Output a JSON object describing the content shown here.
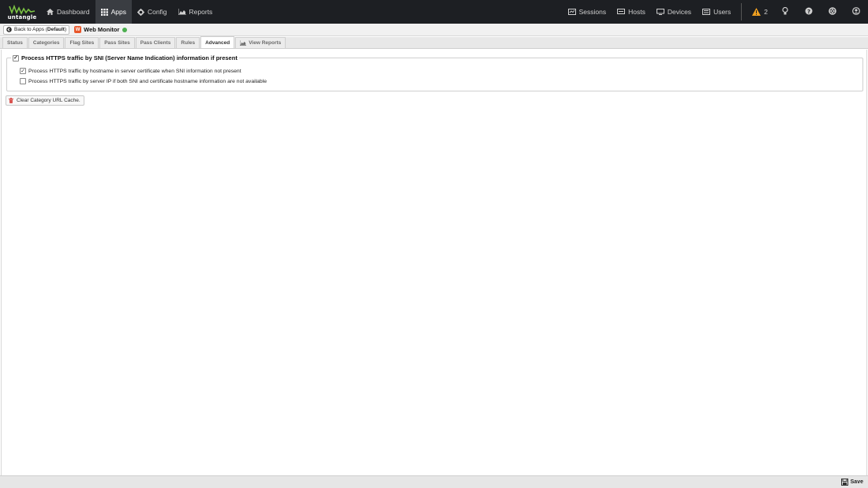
{
  "topnav": {
    "logo_text": "untangle",
    "items": [
      {
        "label": "Dashboard",
        "icon": "home-icon"
      },
      {
        "label": "Apps",
        "icon": "grid-icon",
        "active": true
      },
      {
        "label": "Config",
        "icon": "gear-icon"
      },
      {
        "label": "Reports",
        "icon": "area-chart-icon"
      }
    ],
    "right_items": [
      {
        "label": "Sessions",
        "icon": "sessions-icon"
      },
      {
        "label": "Hosts",
        "icon": "hosts-icon"
      },
      {
        "label": "Devices",
        "icon": "devices-icon"
      },
      {
        "label": "Users",
        "icon": "users-icon"
      }
    ],
    "alert_count": "2"
  },
  "appbar": {
    "back_prefix": "Back to Apps (",
    "back_policy": "Default",
    "back_suffix": ")",
    "app_name": "Web Monitor",
    "app_icon_letter": "W",
    "status_color": "#4caf50"
  },
  "tabs": [
    {
      "label": "Status"
    },
    {
      "label": "Categories"
    },
    {
      "label": "Flag Sites"
    },
    {
      "label": "Pass Sites"
    },
    {
      "label": "Pass Clients"
    },
    {
      "label": "Rules"
    },
    {
      "label": "Advanced",
      "active": true
    },
    {
      "label": "View Reports",
      "icon": "area-chart-icon"
    }
  ],
  "advanced": {
    "sni_label": "Process HTTPS traffic by SNI (Server Name Indication) information if present",
    "sni_checked": true,
    "hostname_label": "Process HTTPS traffic by hostname in server certificate when SNI information not present",
    "hostname_checked": true,
    "ip_label": "Process HTTPS traffic by server IP if both SNI and certificate hostname information are not available",
    "ip_checked": false,
    "clear_cache_label": "Clear Category URL Cache."
  },
  "bottombar": {
    "save_label": "Save"
  },
  "colors": {
    "nav_bg": "#1d1f23",
    "accent_orange": "#f0a020",
    "app_icon": "#e8562a"
  }
}
